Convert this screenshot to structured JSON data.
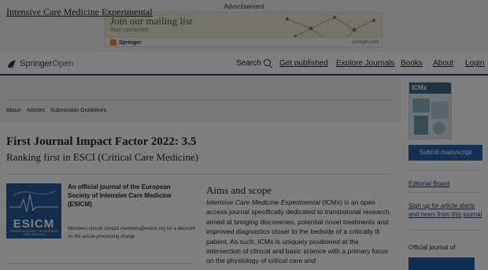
{
  "advert": {
    "label": "Advertisement",
    "headline": "Join our mailing list",
    "subline": "Stay connected",
    "brand": "Springer",
    "url": "springer.com"
  },
  "header": {
    "logo_brand": "Springer",
    "logo_suffix": "Open",
    "search_label": "Search",
    "nav": {
      "get_published": "Get published",
      "explore_journals": "Explore Journals",
      "books": "Books",
      "about": "About",
      "login": "Login"
    }
  },
  "journal": {
    "title": "Intensive Care Medicine Experimental",
    "subnav": [
      "About",
      "Articles",
      "Submission Guidelines"
    ]
  },
  "sidebar": {
    "cover_mast": "ICMx",
    "submit_label": "Submit manuscript",
    "editorial_board": "Editorial Board",
    "alerts_line1": "Sign up for article alerts",
    "alerts_line2": "and news from this journal",
    "official_journal": "Official journal of"
  },
  "main": {
    "headline": "First Journal Impact Factor 2022: 3.5",
    "subheadline": "Ranking first in ESCI (Critical Care Medicine)",
    "esicm_word": "ESICM",
    "esicm_tiny": "EUROPEAN SOCIETY OF INTENSIVE CARE MEDICINE",
    "official_text": "An official journal of the European Society of Intensive Care Medicine (ESICM)",
    "members_text": "Members should contact members@esicm.org for a discount on the article-processing charge.",
    "aims_title": "Aims and scope",
    "aims_italic": "Intensive Care Medicine Experimental",
    "aims_rest": " (ICMx) is an open access journal specifically dedicated to translational research, aimed at bringing discoveries, potential novel treatments and improved diagnostics closer to the bedside of a critically ill patient. As such, ICMx is uniquely positioned at the intersection of clinical and basic science with a primary focus on the physiology of critical care and"
  },
  "colors": {
    "navy": "#1c3f6e",
    "submit_blue": "#2961aa",
    "esicm_blue": "#2a5a98",
    "overlay": "rgba(0,0,0,0.5)"
  }
}
